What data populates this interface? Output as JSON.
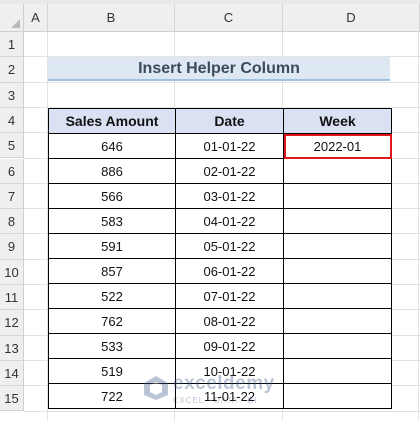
{
  "columns": [
    "A",
    "B",
    "C",
    "D"
  ],
  "rows": [
    "1",
    "2",
    "3",
    "4",
    "5",
    "6",
    "7",
    "8",
    "9",
    "10",
    "11",
    "12",
    "13",
    "14",
    "15"
  ],
  "title": "Insert Helper Column",
  "table": {
    "headers": [
      "Sales Amount",
      "Date",
      "Week"
    ],
    "rows": [
      [
        "646",
        "01-01-22",
        "2022-01"
      ],
      [
        "886",
        "02-01-22",
        ""
      ],
      [
        "566",
        "03-01-22",
        ""
      ],
      [
        "583",
        "04-01-22",
        ""
      ],
      [
        "591",
        "05-01-22",
        ""
      ],
      [
        "857",
        "06-01-22",
        ""
      ],
      [
        "522",
        "07-01-22",
        ""
      ],
      [
        "762",
        "08-01-22",
        ""
      ],
      [
        "533",
        "09-01-22",
        ""
      ],
      [
        "519",
        "10-01-22",
        ""
      ],
      [
        "722",
        "11-01-22",
        ""
      ]
    ]
  },
  "watermark": {
    "name": "exceldemy",
    "tagline": "EXCEL · DATA · BI"
  },
  "colors": {
    "header_fill": "#d9e1f2",
    "title_fill": "#dde8f3",
    "selection": "#e0161b"
  }
}
